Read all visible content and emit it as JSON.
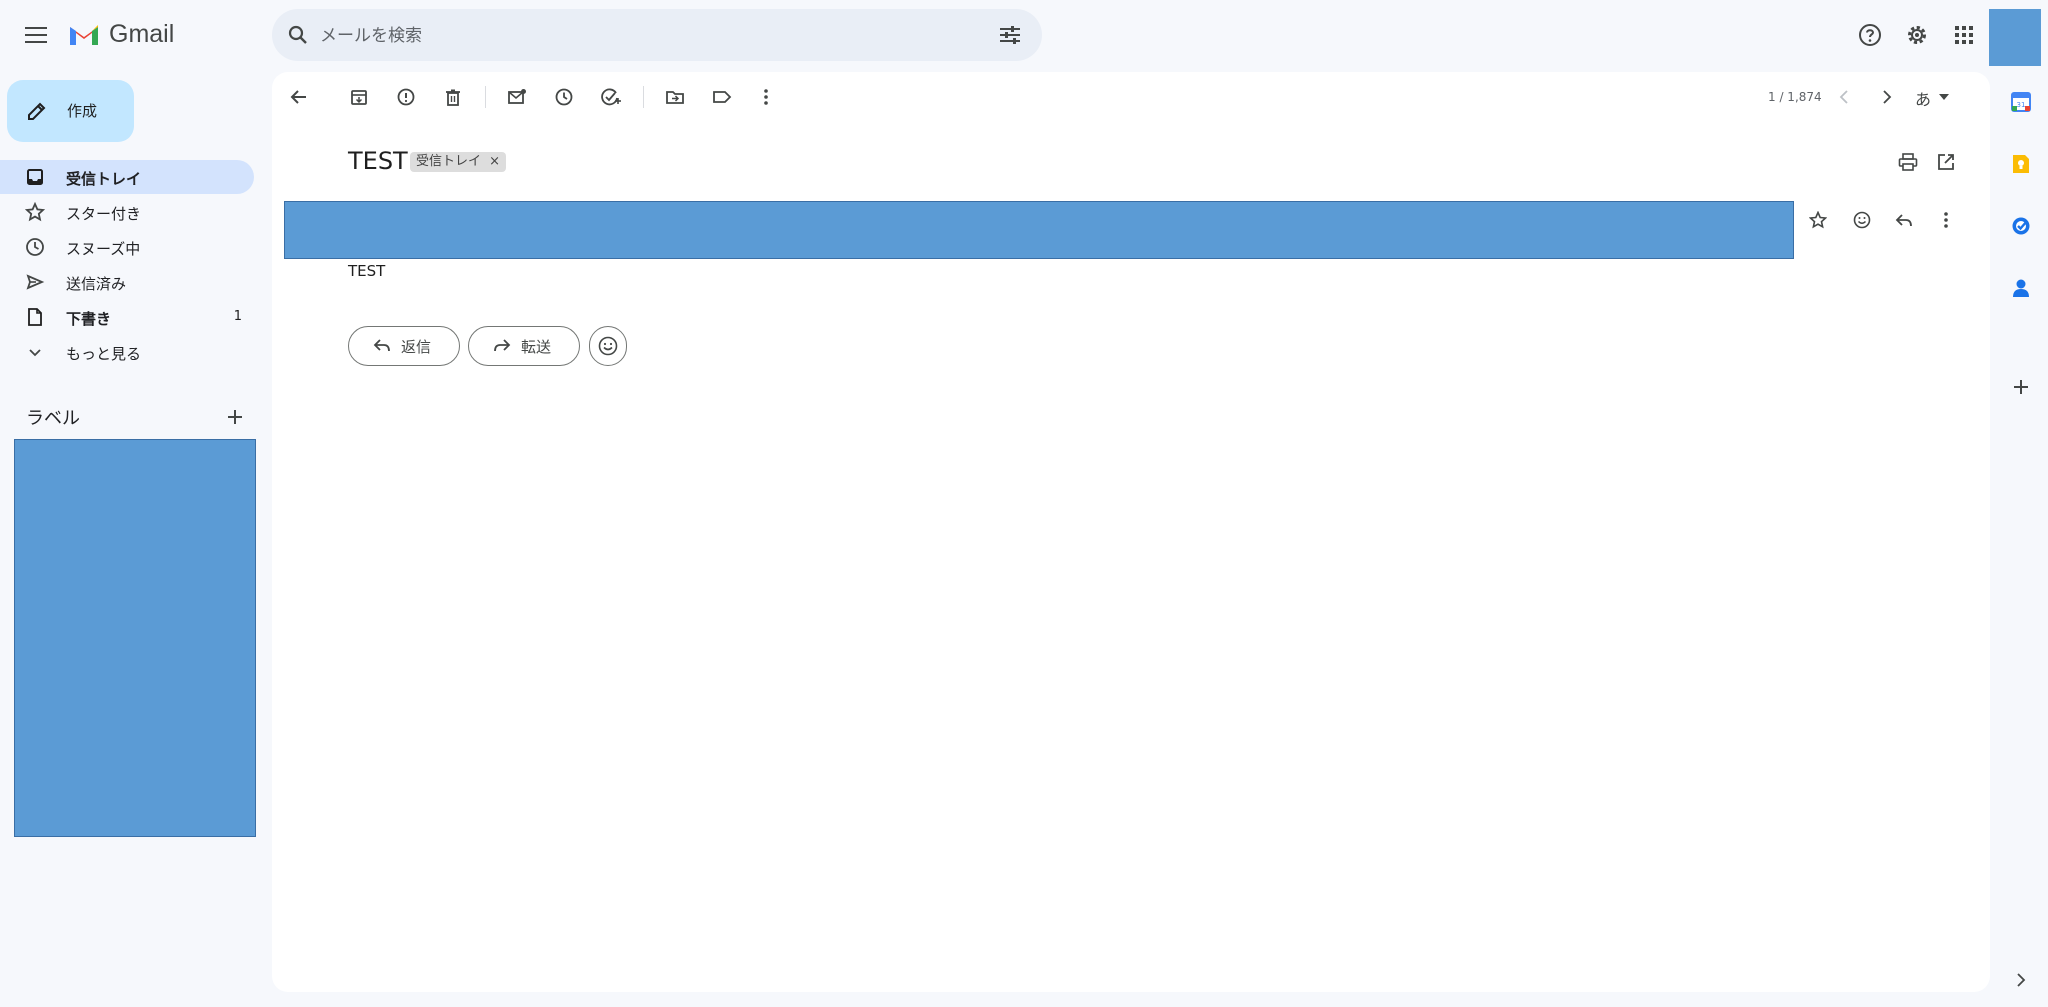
{
  "header": {
    "app_name": "Gmail",
    "search_placeholder": "メールを検索"
  },
  "sidebar": {
    "compose_label": "作成",
    "items": [
      {
        "label": "受信トレイ",
        "icon": "inbox-icon",
        "count": ""
      },
      {
        "label": "スター付き",
        "icon": "star-icon",
        "count": ""
      },
      {
        "label": "スヌーズ中",
        "icon": "clock-icon",
        "count": ""
      },
      {
        "label": "送信済み",
        "icon": "send-icon",
        "count": ""
      },
      {
        "label": "下書き",
        "icon": "draft-icon",
        "count": "1"
      },
      {
        "label": "もっと見る",
        "icon": "chevron-down-icon",
        "count": ""
      }
    ],
    "labels_title": "ラベル"
  },
  "toolbar": {
    "pager": "1 / 1,874",
    "input_tool": "あ"
  },
  "message": {
    "subject": "TEST",
    "label_badge": "受信トレイ",
    "badge_close": "×",
    "body": "TEST"
  },
  "actions": {
    "reply_label": "返信",
    "forward_label": "転送"
  },
  "colors": {
    "background": "#f6f8fc",
    "compose": "#c2e7ff",
    "active_nav": "#d3e3fd",
    "redaction": "#5b9bd5"
  }
}
